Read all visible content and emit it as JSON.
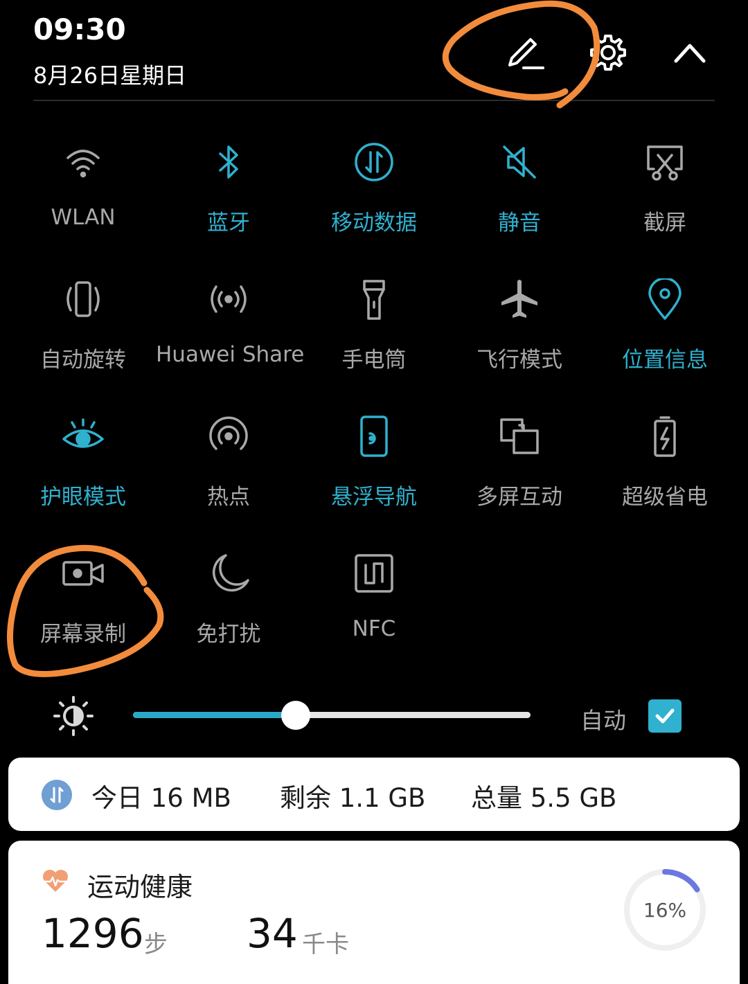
{
  "status": {
    "time": "09:30",
    "date": "8月26日星期日"
  },
  "header_actions": [
    {
      "name": "edit-icon"
    },
    {
      "name": "gear-icon"
    },
    {
      "name": "chevron-up-icon"
    }
  ],
  "tiles": [
    {
      "label": "WLAN",
      "icon": "wifi-icon",
      "active": false
    },
    {
      "label": "蓝牙",
      "icon": "bluetooth-icon",
      "active": true
    },
    {
      "label": "移动数据",
      "icon": "mobile-data-icon",
      "active": true
    },
    {
      "label": "静音",
      "icon": "mute-icon",
      "active": true
    },
    {
      "label": "截屏",
      "icon": "screenshot-icon",
      "active": false
    },
    {
      "label": "自动旋转",
      "icon": "auto-rotate-icon",
      "active": false
    },
    {
      "label": "Huawei Share",
      "icon": "huawei-share-icon",
      "active": false
    },
    {
      "label": "手电筒",
      "icon": "flashlight-icon",
      "active": false
    },
    {
      "label": "飞行模式",
      "icon": "airplane-icon",
      "active": false
    },
    {
      "label": "位置信息",
      "icon": "location-icon",
      "active": true
    },
    {
      "label": "护眼模式",
      "icon": "eye-icon",
      "active": true
    },
    {
      "label": "热点",
      "icon": "hotspot-icon",
      "active": false
    },
    {
      "label": "悬浮导航",
      "icon": "floating-nav-icon",
      "active": true
    },
    {
      "label": "多屏互动",
      "icon": "multi-screen-icon",
      "active": false
    },
    {
      "label": "超级省电",
      "icon": "battery-saver-icon",
      "active": false
    },
    {
      "label": "屏幕录制",
      "icon": "screen-record-icon",
      "active": false
    },
    {
      "label": "免打扰",
      "icon": "moon-icon",
      "active": false
    },
    {
      "label": "NFC",
      "icon": "nfc-icon",
      "active": false
    }
  ],
  "brightness": {
    "icon": "brightness-icon",
    "level": 0.41,
    "auto_label": "自动",
    "auto_checked": true
  },
  "data_usage": {
    "icon": "mobile-data-icon",
    "today": "今日 16 MB",
    "remaining": "剩余 1.1 GB",
    "total": "总量 5.5 GB"
  },
  "health": {
    "icon": "heart-pulse-icon",
    "title": "运动健康",
    "steps": "1296",
    "steps_unit": "步",
    "calories": "34",
    "calories_unit": "千卡",
    "progress_label": "16%",
    "progress": 0.16
  },
  "colors": {
    "accent": "#2fb1cf",
    "inactive": "#a9a9a9",
    "background": "#000000",
    "annotation": "#f28c3c"
  }
}
